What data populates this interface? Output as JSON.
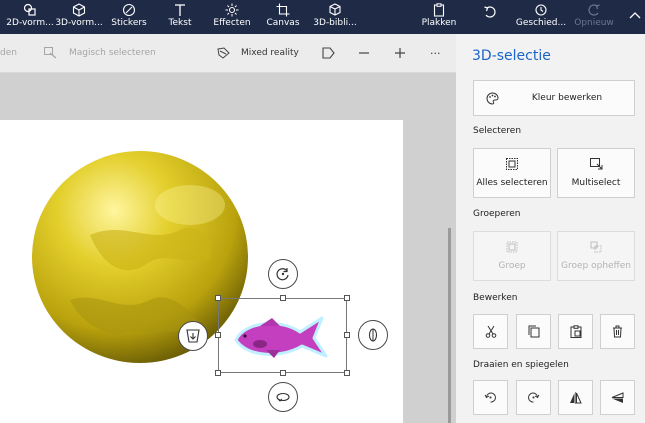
{
  "topbar": {
    "tools": [
      {
        "label": "2D-vorm...",
        "icon": "2d-shapes-icon"
      },
      {
        "label": "3D-vorm...",
        "icon": "3d-shapes-icon"
      },
      {
        "label": "Stickers",
        "icon": "stickers-icon"
      },
      {
        "label": "Tekst",
        "icon": "text-icon"
      },
      {
        "label": "Effecten",
        "icon": "effects-icon"
      },
      {
        "label": "Canvas",
        "icon": "canvas-icon"
      },
      {
        "label": "3D-bibli...",
        "icon": "3d-library-icon"
      }
    ],
    "paste_label": "Plakken",
    "history_label": "Geschied...",
    "redo_label": "Opnieuw"
  },
  "toolbar2": {
    "left_partial_label": "den",
    "magic_select_label": "Magisch selecteren",
    "mixed_reality_label": "Mixed reality",
    "more_label": "···"
  },
  "panel": {
    "title": "3D-selectie",
    "edit_color_label": "Kleur bewerken",
    "select_section": "Selecteren",
    "select_all_label": "Alles selecteren",
    "multiselect_label": "Multiselect",
    "group_section": "Groeperen",
    "group_label": "Groep",
    "ungroup_label": "Groep opheffen",
    "edit_section": "Bewerken",
    "rotate_section": "Draaien en spiegelen"
  },
  "colors": {
    "topbar_bg": "#1f2b46",
    "accent": "#1a64c8",
    "ball": "#d8c41a",
    "fish": "#c33fbf"
  }
}
